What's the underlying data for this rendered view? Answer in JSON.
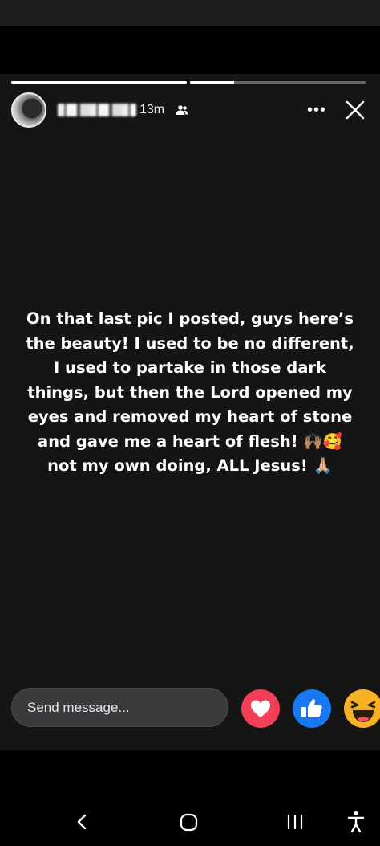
{
  "story": {
    "progress": [
      1.0,
      0.25
    ],
    "author": {
      "name_redacted": true,
      "time": "13m",
      "audience_icon": "friends-icon"
    },
    "more_icon": "more-horizontal-icon",
    "more_label": "•••",
    "close_icon": "close-icon",
    "text": "On that last pic I posted, guys here’s\nthe beauty! I used to be no different,\nI used to partake in those dark\nthings, but then the Lord opened my\neyes and removed my heart of stone\nand gave me a heart of flesh! 🙌🏽🥰\nnot my own doing, ALL Jesus! 🙏🏼"
  },
  "footer": {
    "send_placeholder": "Send message...",
    "reactions": [
      "love-reaction-icon",
      "like-reaction-icon",
      "haha-reaction-icon"
    ]
  },
  "colors": {
    "story_bg": "#151515",
    "input_bg": "#3a3b3c",
    "love": "#f33e58",
    "like": "#1877f2",
    "haha": "#f7b125"
  },
  "nav_bar": {
    "buttons": [
      "back-icon",
      "home-icon",
      "recents-icon",
      "accessibility-icon"
    ]
  }
}
